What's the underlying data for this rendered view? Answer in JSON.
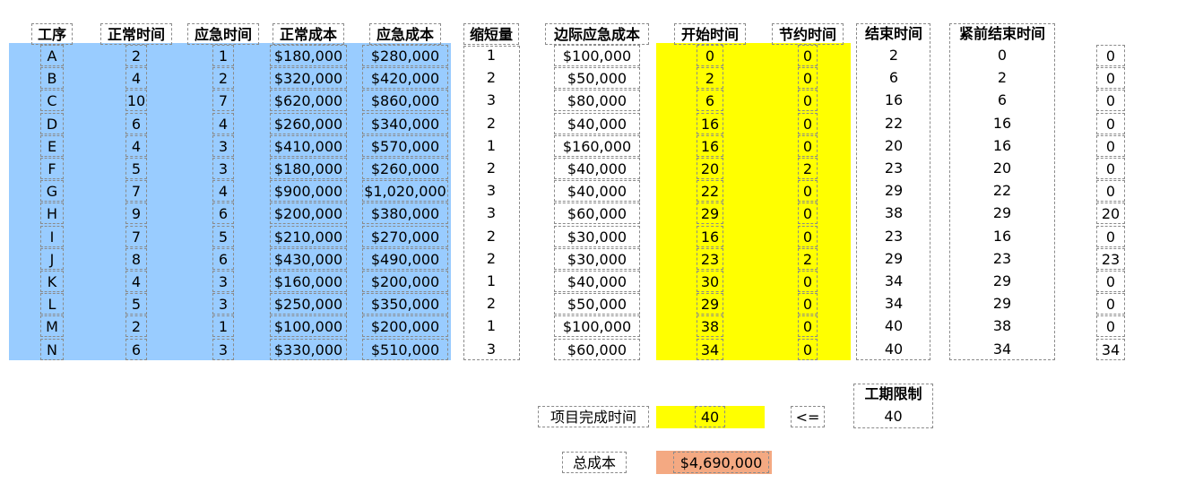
{
  "headers": {
    "task": "工序",
    "normal_time": "正常时间",
    "crash_time": "应急时间",
    "normal_cost": "正常成本",
    "crash_cost": "应急成本",
    "reduction": "缩短量",
    "marginal_cost": "边际应急成本",
    "start_time": "开始时间",
    "saved_time": "节约时间",
    "finish_time": "结束时间",
    "pred_finish": "紧前结束时间"
  },
  "rows": [
    {
      "task": "A",
      "normal_time": "2",
      "crash_time": "1",
      "normal_cost": "$180,000",
      "crash_cost": "$280,000",
      "reduction": "1",
      "marginal_cost": "$100,000",
      "start_time": "0",
      "saved_time": "0",
      "finish_time": "2",
      "pred_finish": "0",
      "extra": "0"
    },
    {
      "task": "B",
      "normal_time": "4",
      "crash_time": "2",
      "normal_cost": "$320,000",
      "crash_cost": "$420,000",
      "reduction": "2",
      "marginal_cost": "$50,000",
      "start_time": "2",
      "saved_time": "0",
      "finish_time": "6",
      "pred_finish": "2",
      "extra": "0"
    },
    {
      "task": "C",
      "normal_time": "10",
      "crash_time": "7",
      "normal_cost": "$620,000",
      "crash_cost": "$860,000",
      "reduction": "3",
      "marginal_cost": "$80,000",
      "start_time": "6",
      "saved_time": "0",
      "finish_time": "16",
      "pred_finish": "6",
      "extra": "0"
    },
    {
      "task": "D",
      "normal_time": "6",
      "crash_time": "4",
      "normal_cost": "$260,000",
      "crash_cost": "$340,000",
      "reduction": "2",
      "marginal_cost": "$40,000",
      "start_time": "16",
      "saved_time": "0",
      "finish_time": "22",
      "pred_finish": "16",
      "extra": "0"
    },
    {
      "task": "E",
      "normal_time": "4",
      "crash_time": "3",
      "normal_cost": "$410,000",
      "crash_cost": "$570,000",
      "reduction": "1",
      "marginal_cost": "$160,000",
      "start_time": "16",
      "saved_time": "0",
      "finish_time": "20",
      "pred_finish": "16",
      "extra": "0"
    },
    {
      "task": "F",
      "normal_time": "5",
      "crash_time": "3",
      "normal_cost": "$180,000",
      "crash_cost": "$260,000",
      "reduction": "2",
      "marginal_cost": "$40,000",
      "start_time": "20",
      "saved_time": "2",
      "finish_time": "23",
      "pred_finish": "20",
      "extra": "0"
    },
    {
      "task": "G",
      "normal_time": "7",
      "crash_time": "4",
      "normal_cost": "$900,000",
      "crash_cost": "$1,020,000",
      "reduction": "3",
      "marginal_cost": "$40,000",
      "start_time": "22",
      "saved_time": "0",
      "finish_time": "29",
      "pred_finish": "22",
      "extra": "0"
    },
    {
      "task": "H",
      "normal_time": "9",
      "crash_time": "6",
      "normal_cost": "$200,000",
      "crash_cost": "$380,000",
      "reduction": "3",
      "marginal_cost": "$60,000",
      "start_time": "29",
      "saved_time": "0",
      "finish_time": "38",
      "pred_finish": "29",
      "extra": "20"
    },
    {
      "task": "I",
      "normal_time": "7",
      "crash_time": "5",
      "normal_cost": "$210,000",
      "crash_cost": "$270,000",
      "reduction": "2",
      "marginal_cost": "$30,000",
      "start_time": "16",
      "saved_time": "0",
      "finish_time": "23",
      "pred_finish": "16",
      "extra": "0"
    },
    {
      "task": "J",
      "normal_time": "8",
      "crash_time": "6",
      "normal_cost": "$430,000",
      "crash_cost": "$490,000",
      "reduction": "2",
      "marginal_cost": "$30,000",
      "start_time": "23",
      "saved_time": "2",
      "finish_time": "29",
      "pred_finish": "23",
      "extra": "23"
    },
    {
      "task": "K",
      "normal_time": "4",
      "crash_time": "3",
      "normal_cost": "$160,000",
      "crash_cost": "$200,000",
      "reduction": "1",
      "marginal_cost": "$40,000",
      "start_time": "30",
      "saved_time": "0",
      "finish_time": "34",
      "pred_finish": "29",
      "extra": "0"
    },
    {
      "task": "L",
      "normal_time": "5",
      "crash_time": "3",
      "normal_cost": "$250,000",
      "crash_cost": "$350,000",
      "reduction": "2",
      "marginal_cost": "$50,000",
      "start_time": "29",
      "saved_time": "0",
      "finish_time": "34",
      "pred_finish": "29",
      "extra": "0"
    },
    {
      "task": "M",
      "normal_time": "2",
      "crash_time": "1",
      "normal_cost": "$100,000",
      "crash_cost": "$200,000",
      "reduction": "1",
      "marginal_cost": "$100,000",
      "start_time": "38",
      "saved_time": "0",
      "finish_time": "40",
      "pred_finish": "38",
      "extra": "0"
    },
    {
      "task": "N",
      "normal_time": "6",
      "crash_time": "3",
      "normal_cost": "$330,000",
      "crash_cost": "$510,000",
      "reduction": "3",
      "marginal_cost": "$60,000",
      "start_time": "34",
      "saved_time": "0",
      "finish_time": "40",
      "pred_finish": "34",
      "extra": "34"
    }
  ],
  "summary": {
    "completion_label": "项目完成时间",
    "completion_value": "40",
    "operator": "<=",
    "deadline_label": "工期限制",
    "deadline_value": "40",
    "total_cost_label": "总成本",
    "total_cost_value": "$4,690,000"
  },
  "colors": {
    "input_fill": "#99ccff",
    "changing_fill": "#ffff00",
    "result_fill": "#f4a982"
  }
}
